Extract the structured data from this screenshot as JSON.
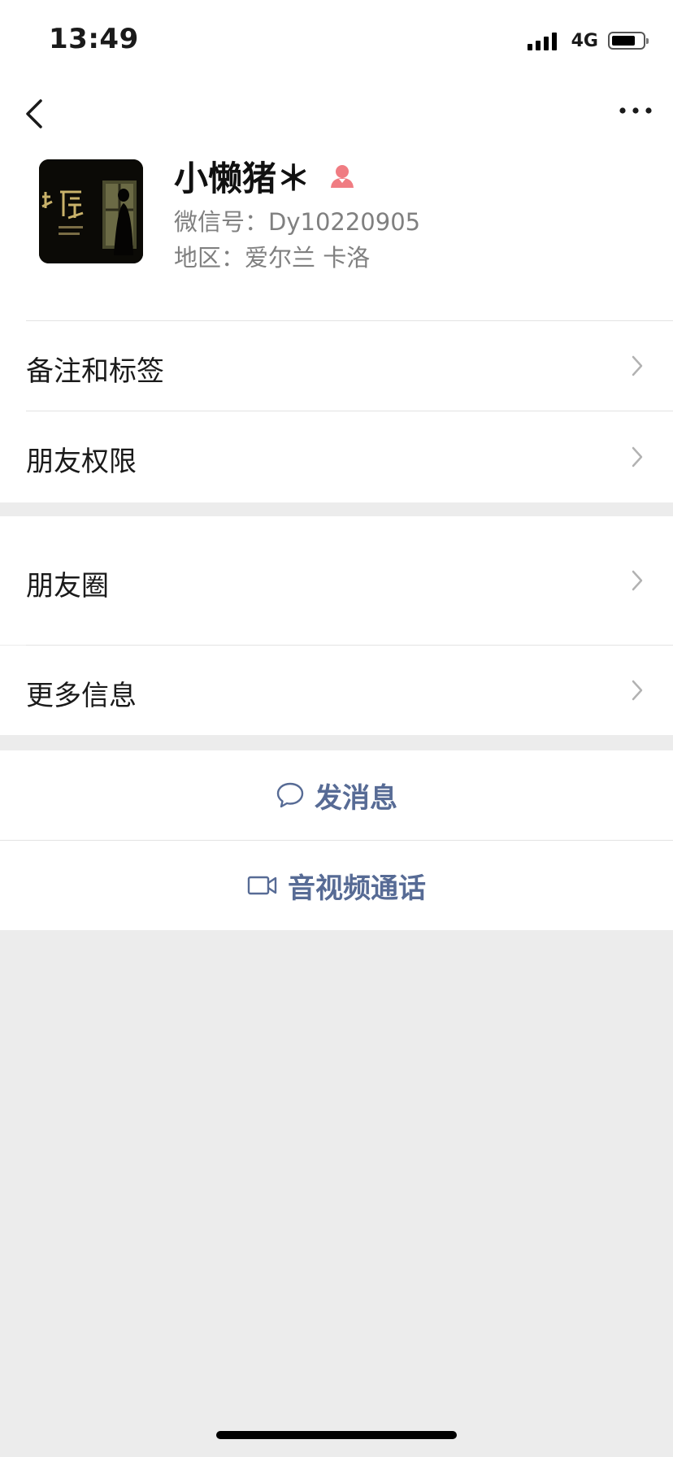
{
  "status_bar": {
    "time": "13:49",
    "network": "4G"
  },
  "profile": {
    "name": "小懒猪＊",
    "wechat_id": "微信号：Dy10220905",
    "region": "地区：爱尔兰 卡洛",
    "gender_icon": "female-icon"
  },
  "menu_group1": [
    {
      "label": "备注和标签"
    },
    {
      "label": "朋友权限"
    }
  ],
  "menu_group2": [
    {
      "label": "朋友圈"
    },
    {
      "label": "更多信息"
    }
  ],
  "actions": {
    "message": "发消息",
    "call": "音视频通话"
  },
  "colors": {
    "accent": "#576b95",
    "female": "#f07c82",
    "background": "#ececec"
  }
}
